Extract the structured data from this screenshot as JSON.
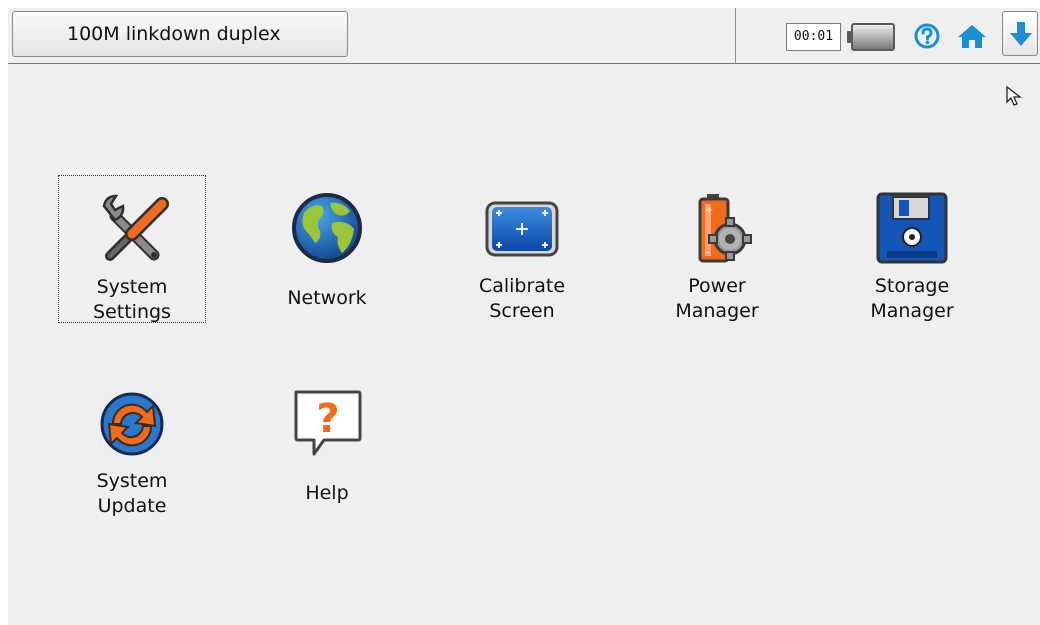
{
  "topbar": {
    "status_label": "100M linkdown duplex",
    "clock": "00:01",
    "icons": {
      "battery": "battery-icon",
      "help": "help-circle-icon",
      "home": "home-icon",
      "down": "arrow-down-icon"
    },
    "accent_color": "#1a8fd6"
  },
  "apps": [
    {
      "line1": "System",
      "line2": "Settings",
      "icon": "tools-icon"
    },
    {
      "line1": "Network",
      "icon": "globe-icon"
    },
    {
      "line1": "Calibrate",
      "line2": "Screen",
      "icon": "calibrate-icon"
    },
    {
      "line1": "Power",
      "line2": "Manager",
      "icon": "battery-gear-icon"
    },
    {
      "line1": "Storage",
      "line2": "Manager",
      "icon": "floppy-disk-icon"
    },
    {
      "line1": "System",
      "line2": "Update",
      "icon": "refresh-icon"
    },
    {
      "line1": "Help",
      "icon": "help-bubble-icon"
    }
  ]
}
